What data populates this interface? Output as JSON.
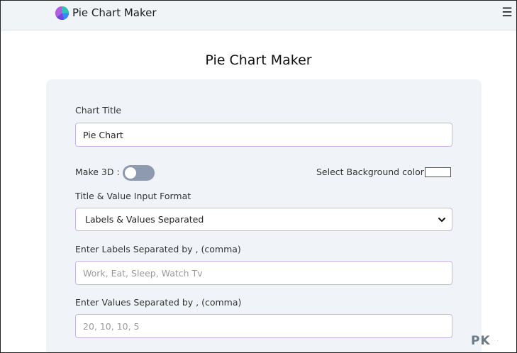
{
  "header": {
    "brand": "Pie Chart Maker"
  },
  "main": {
    "title": "Pie Chart Maker"
  },
  "form": {
    "chart_title_label": "Chart Title",
    "chart_title_value": "Pie Chart",
    "make_3d_label": "Make 3D :",
    "make_3d_enabled": false,
    "bg_color_label": "Select Background color:",
    "bg_color_value": "#ffffff",
    "input_format_label": "Title & Value Input Format",
    "input_format_selected": "Labels & Values Separated",
    "labels_label": "Enter Labels Separated by , (comma)",
    "labels_placeholder": "Work, Eat, Sleep, Watch Tv",
    "values_label": "Enter Values Separated by , (comma)",
    "values_placeholder": "20, 10, 10, 5"
  },
  "watermark": {
    "text": "PK",
    "sub": "· · ·"
  },
  "icons": {
    "logo": "pie-chart-logo-icon",
    "menu": "hamburger-menu-icon",
    "chevron": "chevron-down-icon"
  },
  "colors": {
    "accent_border": "#c7b3e8",
    "panel_bg": "#f0f3f7",
    "toggle_off": "#8e9aaf"
  }
}
